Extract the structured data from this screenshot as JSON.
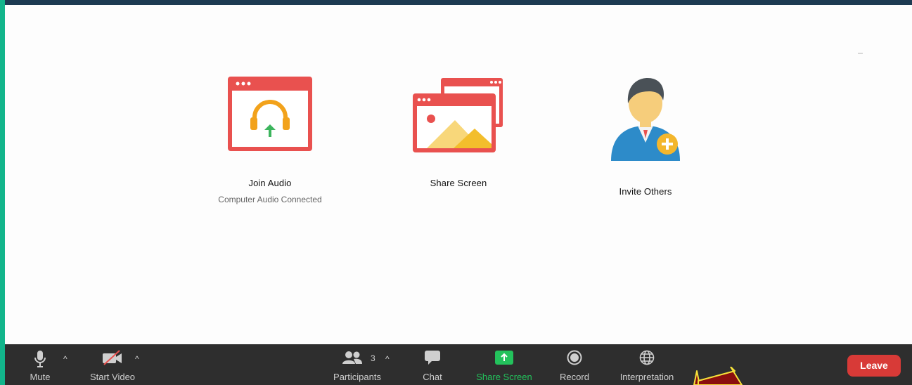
{
  "main": {
    "actions": [
      {
        "label": "Join Audio",
        "sub": "Computer Audio Connected"
      },
      {
        "label": "Share Screen",
        "sub": ""
      },
      {
        "label": "Invite Others",
        "sub": ""
      }
    ]
  },
  "toolbar": {
    "mute_label": "Mute",
    "start_video_label": "Start Video",
    "participants_label": "Participants",
    "participants_count": "3",
    "chat_label": "Chat",
    "share_screen_label": "Share Screen",
    "record_label": "Record",
    "interpretation_label": "Interpretation",
    "leave_label": "Leave",
    "caret": "^"
  },
  "colors": {
    "accent_green": "#23c25c",
    "leave_red": "#d83a37",
    "toolbar_bg": "#2e2e2e",
    "frame_teal": "#12b58b",
    "annotation_arrow": "#8b0e0e"
  },
  "icons": [
    "microphone-icon",
    "video-off-icon",
    "participants-icon",
    "chat-icon",
    "share-screen-icon",
    "record-icon",
    "globe-icon"
  ]
}
